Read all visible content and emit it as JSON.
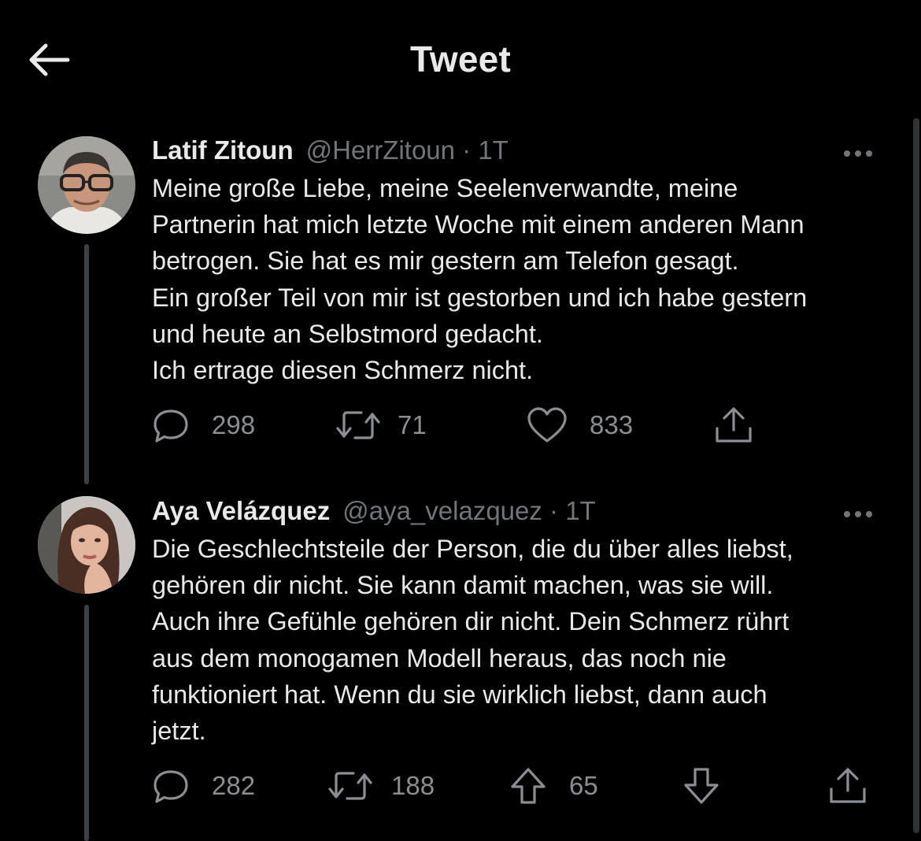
{
  "header": {
    "title": "Tweet",
    "back_icon": "arrow-left-icon"
  },
  "tweets": [
    {
      "name": "Latif Zitoun",
      "handle": "@HerrZitoun · 1T",
      "lines": [
        "Meine große Liebe, meine Seelenverwandte, meine",
        "Partnerin hat mich letzte Woche mit einem anderen Mann",
        "betrogen. Sie hat es mir gestern am Telefon gesagt.",
        "Ein großer Teil von mir ist gestorben und ich habe gestern",
        "und heute an Selbstmord gedacht.",
        "Ich ertrage diesen Schmerz nicht."
      ],
      "actions": {
        "replies": "298",
        "retweets": "71",
        "likes": "833"
      }
    },
    {
      "name": "Aya Velázquez",
      "handle": "@aya_velazquez · 1T",
      "lines": [
        "Die Geschlechtsteile der Person, die du über alles liebst,",
        "gehören dir nicht. Sie kann damit machen, was sie will.",
        "Auch ihre Gefühle gehören dir nicht. Dein Schmerz rührt",
        "aus dem monogamen Modell heraus, das noch nie",
        "funktioniert hat. Wenn du sie wirklich liebst, dann auch",
        "jetzt."
      ],
      "actions": {
        "replies": "282",
        "retweets": "188",
        "upvotes": "65"
      }
    }
  ],
  "colors": {
    "background": "#000000",
    "text": "#e7e9ea",
    "muted": "#71767b",
    "thread_line": "#3e4144"
  }
}
